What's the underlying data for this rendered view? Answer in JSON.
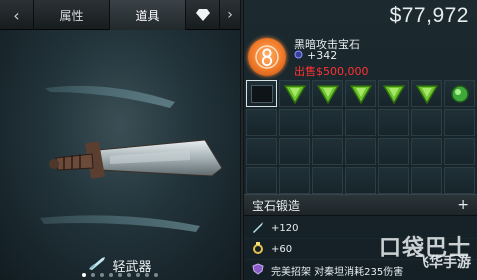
{
  "tabs": {
    "back_icon": "chevron-left-icon",
    "items": [
      {
        "label": "属性",
        "active": false
      },
      {
        "label": "道具",
        "active": true
      }
    ],
    "gem_icon": "diamond-icon",
    "forward_icon": "chevron-right-icon"
  },
  "left": {
    "weapon_type_label": "轻武器",
    "weapon_type_icon": "sword-icon",
    "pagination": {
      "count": 9,
      "active_index": 0
    }
  },
  "money": {
    "display": "$77,972"
  },
  "item": {
    "name": "黑暗攻击宝石",
    "stat": "+342",
    "price": "出售$500,000",
    "icon": "gem-8-icon",
    "icon_numeral": "8"
  },
  "inventory": {
    "slots": [
      {
        "type": "empty-selected"
      },
      {
        "type": "arrow-gem"
      },
      {
        "type": "arrow-gem"
      },
      {
        "type": "arrow-gem"
      },
      {
        "type": "arrow-gem"
      },
      {
        "type": "arrow-gem"
      },
      {
        "type": "round-gem"
      }
    ],
    "total_slots": 28
  },
  "forge": {
    "label": "宝石锻造",
    "plus": "+"
  },
  "stats": [
    {
      "icon": "sword-icon",
      "text": "+120"
    },
    {
      "icon": "ring-icon",
      "text": "+60"
    },
    {
      "icon": "shield-icon",
      "text": "完美招架 对秦坦消耗235伤害"
    }
  ],
  "watermark": {
    "main": "口袋巴士",
    "sub": "飞华手游"
  },
  "colors": {
    "price_red": "#ff3232",
    "gem_green": "#6cc52b",
    "gem_orange": "#f07a28"
  }
}
